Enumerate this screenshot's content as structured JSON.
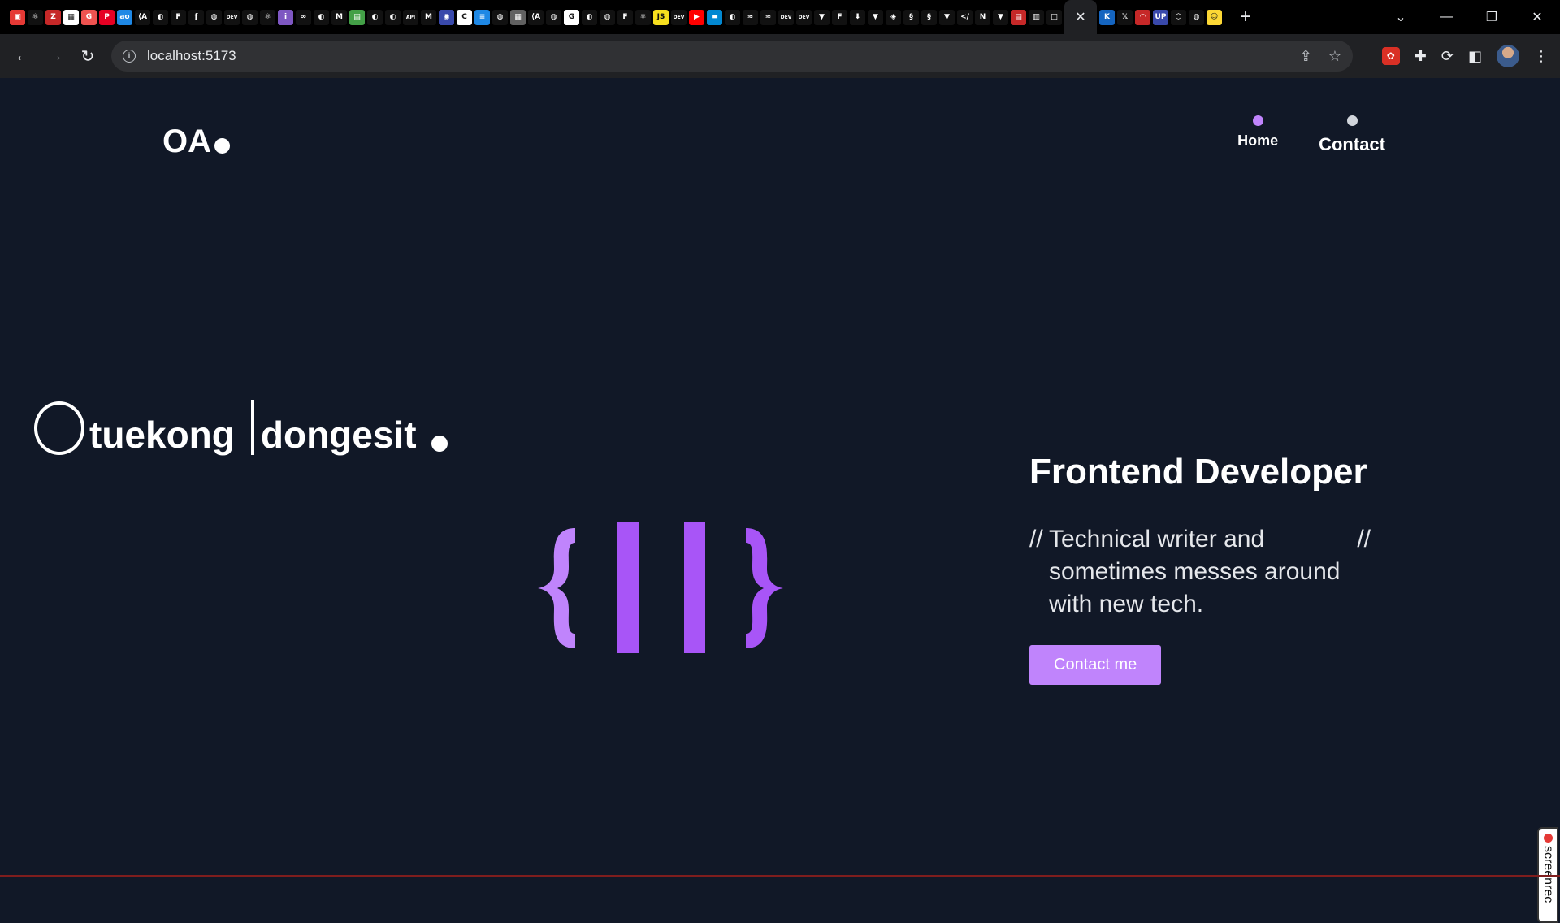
{
  "browser": {
    "url": "localhost:5173",
    "tab_icons": [
      {
        "name": "app-icon",
        "color": "#e53935",
        "glyph": "▣"
      },
      {
        "name": "react-icon",
        "color": "#111",
        "glyph": "⚛"
      },
      {
        "name": "zotero-icon",
        "color": "#c62828",
        "glyph": "Z"
      },
      {
        "name": "app-icon",
        "color": "#fff",
        "glyph": "▦"
      },
      {
        "name": "app-icon",
        "color": "#ef5350",
        "glyph": "G"
      },
      {
        "name": "pinterest-icon",
        "color": "#e60023",
        "glyph": "P"
      },
      {
        "name": "app-icon",
        "color": "#1e88e5",
        "glyph": "ao"
      },
      {
        "name": "app-icon",
        "color": "#111",
        "glyph": "⟨A"
      },
      {
        "name": "github-icon",
        "color": "#111",
        "glyph": "◐"
      },
      {
        "name": "figma-icon",
        "color": "#111",
        "glyph": "F"
      },
      {
        "name": "app-icon",
        "color": "#111",
        "glyph": "ƒ"
      },
      {
        "name": "globe-icon",
        "color": "#111",
        "glyph": "◍"
      },
      {
        "name": "dev-icon",
        "color": "#111",
        "glyph": "DEV"
      },
      {
        "name": "globe-icon",
        "color": "#111",
        "glyph": "◍"
      },
      {
        "name": "react-icon",
        "color": "#111",
        "glyph": "⚛"
      },
      {
        "name": "app-icon",
        "color": "#7e57c2",
        "glyph": "i"
      },
      {
        "name": "app-icon",
        "color": "#111",
        "glyph": "∞"
      },
      {
        "name": "github-icon",
        "color": "#111",
        "glyph": "◐"
      },
      {
        "name": "medium-icon",
        "color": "#111",
        "glyph": "M"
      },
      {
        "name": "app-icon",
        "color": "#43a047",
        "glyph": "▤"
      },
      {
        "name": "github-icon",
        "color": "#111",
        "glyph": "◐"
      },
      {
        "name": "github-icon",
        "color": "#111",
        "glyph": "◐"
      },
      {
        "name": "app-icon",
        "color": "#111",
        "glyph": "API"
      },
      {
        "name": "medium-icon",
        "color": "#111",
        "glyph": "M"
      },
      {
        "name": "app-icon",
        "color": "#3949ab",
        "glyph": "◉"
      },
      {
        "name": "app-icon",
        "color": "#fff",
        "glyph": "C"
      },
      {
        "name": "docs-icon",
        "color": "#1e88e5",
        "glyph": "≡"
      },
      {
        "name": "globe-icon",
        "color": "#111",
        "glyph": "◍"
      },
      {
        "name": "app-icon",
        "color": "#616161",
        "glyph": "▦"
      },
      {
        "name": "app-icon",
        "color": "#111",
        "glyph": "⟨A"
      },
      {
        "name": "globe-icon",
        "color": "#111",
        "glyph": "◍"
      },
      {
        "name": "google-icon",
        "color": "#fff",
        "glyph": "G"
      },
      {
        "name": "github-icon",
        "color": "#111",
        "glyph": "◐"
      },
      {
        "name": "globe-icon",
        "color": "#111",
        "glyph": "◍"
      },
      {
        "name": "figma-icon",
        "color": "#111",
        "glyph": "F"
      },
      {
        "name": "react-icon",
        "color": "#111",
        "glyph": "⚛"
      },
      {
        "name": "js-icon",
        "color": "#f7df1e",
        "glyph": "JS"
      },
      {
        "name": "dev-icon",
        "color": "#111",
        "glyph": "DEV"
      },
      {
        "name": "youtube-icon",
        "color": "#ff0000",
        "glyph": "▶"
      },
      {
        "name": "app-icon",
        "color": "#0288d1",
        "glyph": "▬"
      },
      {
        "name": "github-icon",
        "color": "#111",
        "glyph": "◐"
      },
      {
        "name": "tailwind-icon",
        "color": "#111",
        "glyph": "≈"
      },
      {
        "name": "tailwind-icon",
        "color": "#111",
        "glyph": "≈"
      },
      {
        "name": "dev-icon",
        "color": "#111",
        "glyph": "DEV"
      },
      {
        "name": "dev-icon",
        "color": "#111",
        "glyph": "DEV"
      },
      {
        "name": "vue-icon",
        "color": "#111",
        "glyph": "▼"
      },
      {
        "name": "figma-icon",
        "color": "#111",
        "glyph": "F"
      },
      {
        "name": "download-icon",
        "color": "#111",
        "glyph": "⬇"
      },
      {
        "name": "vue-icon",
        "color": "#111",
        "glyph": "▼"
      },
      {
        "name": "app-icon",
        "color": "#111",
        "glyph": "◈"
      },
      {
        "name": "app-icon",
        "color": "#111",
        "glyph": "§"
      },
      {
        "name": "app-icon",
        "color": "#111",
        "glyph": "§"
      },
      {
        "name": "vue-icon",
        "color": "#111",
        "glyph": "▼"
      },
      {
        "name": "app-icon",
        "color": "#111",
        "glyph": "</"
      },
      {
        "name": "app-icon",
        "color": "#111",
        "glyph": "N"
      },
      {
        "name": "vue-icon",
        "color": "#111",
        "glyph": "▼"
      },
      {
        "name": "app-icon",
        "color": "#c62828",
        "glyph": "▤"
      },
      {
        "name": "app-icon",
        "color": "#111",
        "glyph": "▥"
      },
      {
        "name": "app-icon",
        "color": "#111",
        "glyph": "□"
      }
    ],
    "tab_icons_right": [
      {
        "name": "app-icon",
        "color": "#1565c0",
        "glyph": "K"
      },
      {
        "name": "x-icon",
        "color": "#111",
        "glyph": "𝕏"
      },
      {
        "name": "app-icon",
        "color": "#c62828",
        "glyph": "◠"
      },
      {
        "name": "app-icon",
        "color": "#3949ab",
        "glyph": "UP"
      },
      {
        "name": "app-icon",
        "color": "#111",
        "glyph": "⬡"
      },
      {
        "name": "globe-icon",
        "color": "#111",
        "glyph": "◍"
      },
      {
        "name": "app-icon",
        "color": "#fdd835",
        "glyph": "☺"
      }
    ]
  },
  "site": {
    "logo": "OA",
    "nav": [
      {
        "label": "Home",
        "dot_color": "#c084fc"
      },
      {
        "label": "Contact",
        "dot_color": "#d1d5db"
      }
    ],
    "hero": {
      "first_name_rest": "tuekong",
      "last_name_rest": "dongesit"
    },
    "intro": {
      "title": "Frontend Developer",
      "slash_open": "//",
      "text": "Technical writer and sometimes messes around with new tech.",
      "slash_close": "//",
      "button": "Contact me"
    },
    "accent_color": "#c084fc",
    "logo_colors": [
      "#c084fc",
      "#a855f7"
    ],
    "recorder_label": "screenrec"
  }
}
